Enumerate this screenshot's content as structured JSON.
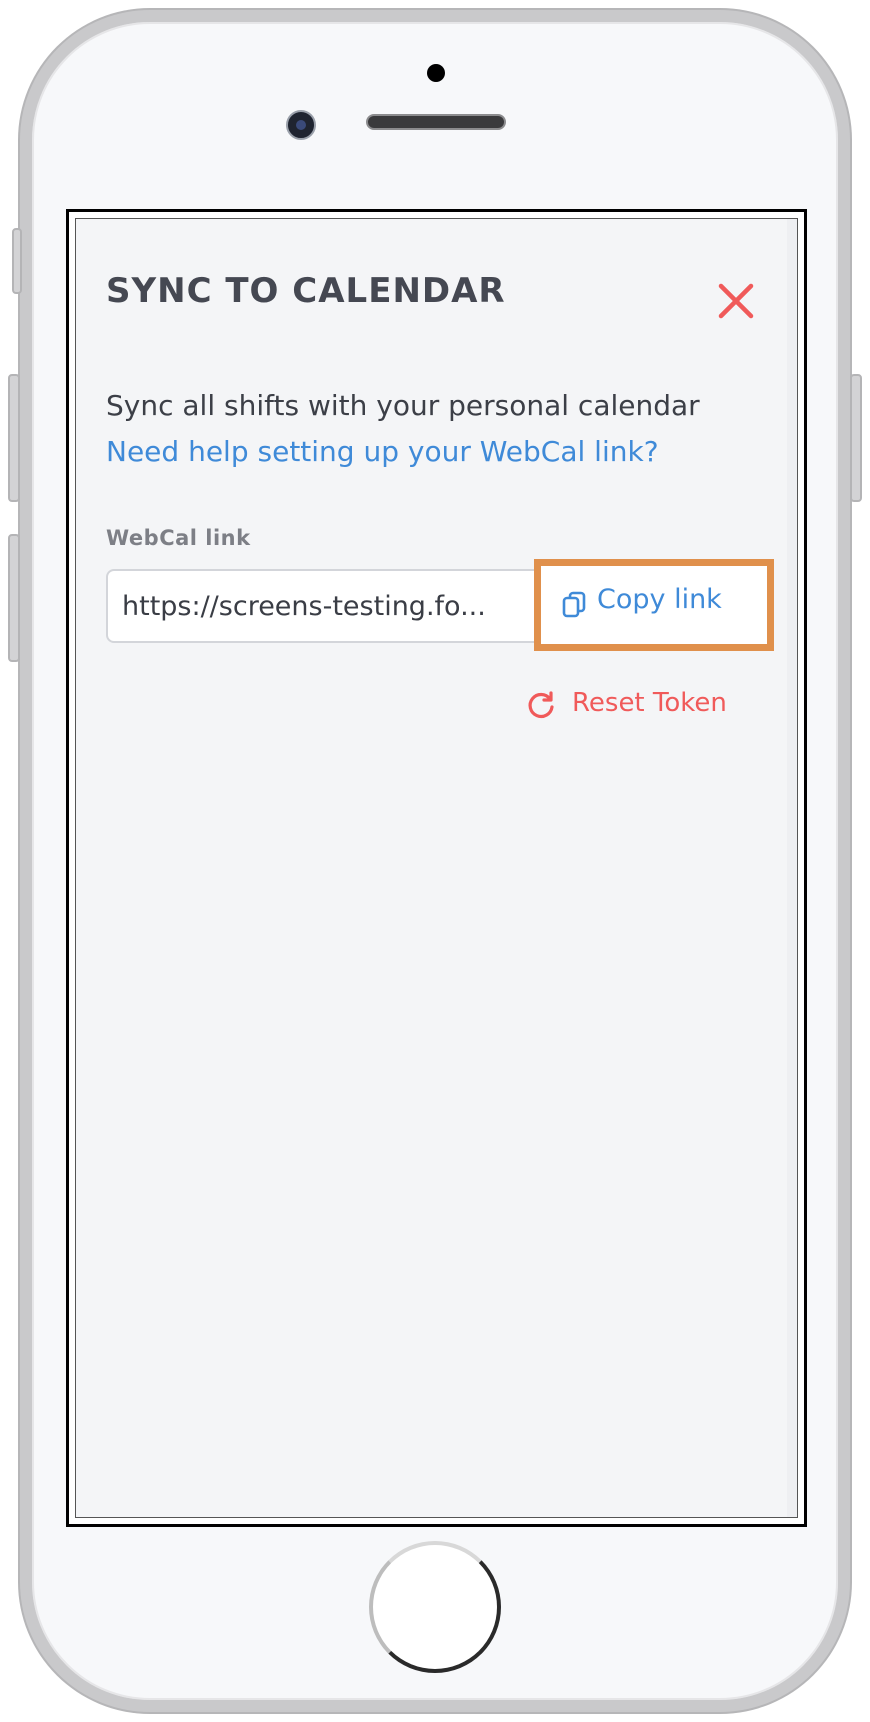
{
  "modal": {
    "title": "SYNC TO CALENDAR",
    "description": "Sync all shifts with your personal calendar",
    "help_link": "Need help setting up your WebCal link?",
    "field_label": "WebCal link",
    "webcal_value": "https://screens-testing.fo...",
    "copy_button_label": "Copy link",
    "reset_token_label": "Reset Token"
  },
  "colors": {
    "title_text": "#454852",
    "link_blue": "#3f8ad8",
    "danger_red": "#f05a5a",
    "highlight_orange": "#e0904c",
    "screen_background": "#f4f5f7"
  },
  "icons": {
    "close": "close-icon",
    "copy": "copy-icon",
    "reset": "refresh-icon"
  }
}
